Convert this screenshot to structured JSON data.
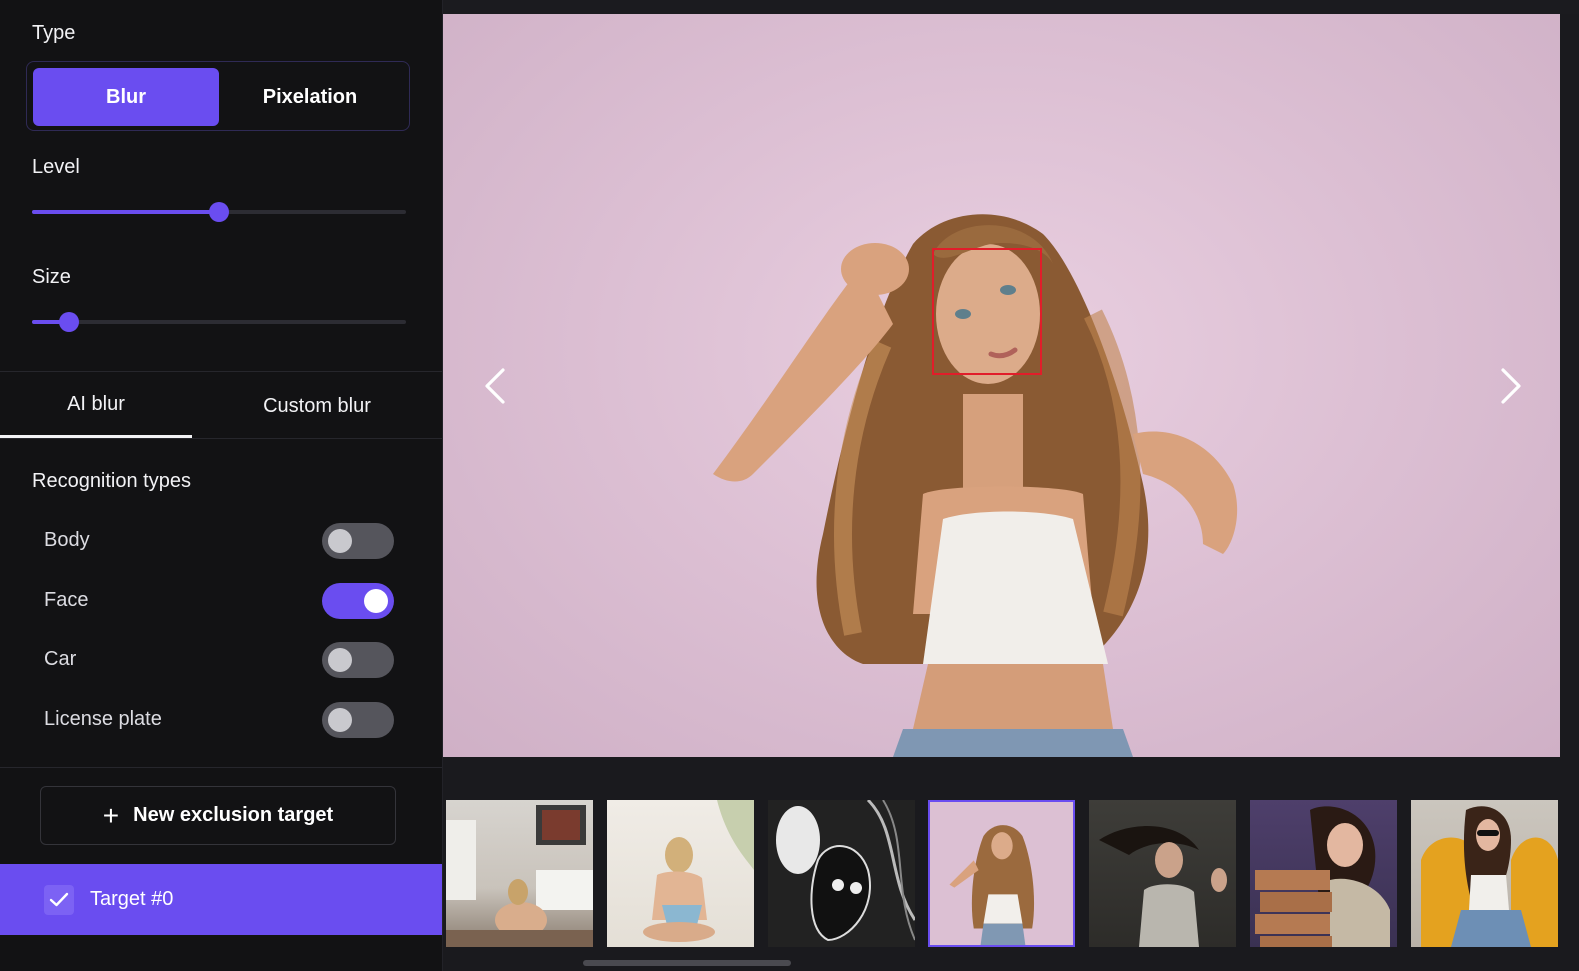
{
  "sidebar": {
    "type": {
      "label": "Type",
      "options": [
        "Blur",
        "Pixelation"
      ],
      "selected": "Blur"
    },
    "level": {
      "label": "Level",
      "value": 0.5
    },
    "size": {
      "label": "Size",
      "value": 0.1
    },
    "tabs": [
      "AI blur",
      "Custom blur"
    ],
    "active_tab": "AI blur",
    "recognition": {
      "label": "Recognition types",
      "items": [
        {
          "label": "Body",
          "on": false
        },
        {
          "label": "Face",
          "on": true
        },
        {
          "label": "Car",
          "on": false
        },
        {
          "label": "License plate",
          "on": false
        }
      ]
    },
    "new_target_label": "New exclusion target",
    "targets": [
      {
        "label": "Target #0",
        "checked": true
      }
    ]
  },
  "viewer": {
    "thumbnail_count": 7,
    "selected_thumbnail": 4
  },
  "colors": {
    "accent": "#6a4df0",
    "face_box": "#e11d2a",
    "bg": "#121214"
  },
  "icons": [
    "chevron-left-icon",
    "chevron-right-icon",
    "plus-icon",
    "check-icon"
  ]
}
